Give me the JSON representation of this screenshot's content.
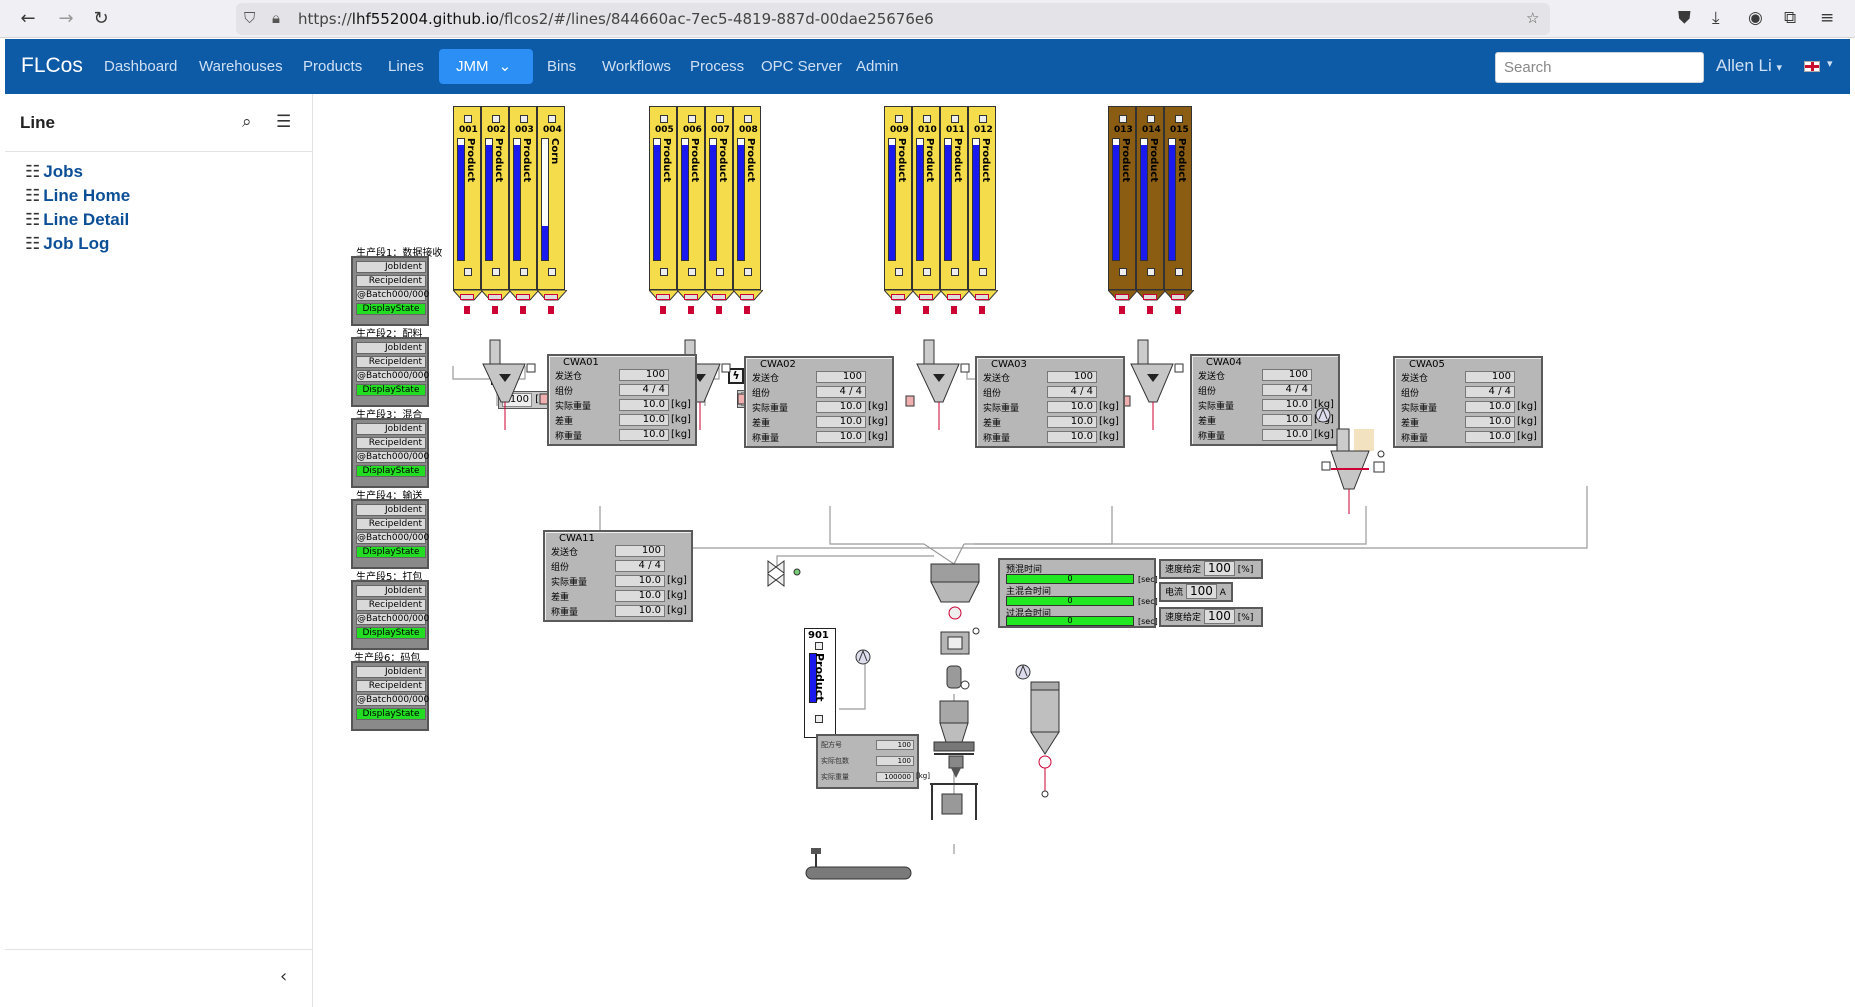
{
  "browser": {
    "url_prefix": "https://",
    "url_host": "lhf552004.github.io",
    "url_path": "/flcos2/#/lines/844660ac-7ec5-4819-887d-00dae25676e6"
  },
  "navbar": {
    "brand": "FLCos",
    "links": [
      "Dashboard",
      "Warehouses",
      "Products",
      "Lines"
    ],
    "dropdown": "JMM",
    "links2": [
      "Bins",
      "Workflows",
      "Process",
      "OPC Server",
      "Admin"
    ],
    "search_placeholder": "Search",
    "user": "Allen Li"
  },
  "sidebar": {
    "title": "Line",
    "items": [
      "Jobs",
      "Line Home",
      "Line Detail",
      "Job Log"
    ]
  },
  "stages": [
    {
      "title": "生产段1：数据接收",
      "job": "JobIdent",
      "recipe": "RecipeIdent",
      "batch": "@Batch000/000",
      "state": "DisplayState"
    },
    {
      "title": "生产段2：配料",
      "job": "JobIdent",
      "recipe": "RecipeIdent",
      "batch": "@Batch000/000",
      "state": "DisplayState"
    },
    {
      "title": "生产段3：混合",
      "job": "JobIdent",
      "recipe": "RecipeIdent",
      "batch": "@Batch000/000",
      "state": "DisplayState"
    },
    {
      "title": "生产段4：输送",
      "job": "JobIdent",
      "recipe": "RecipeIdent",
      "batch": "@Batch000/000",
      "state": "DisplayState"
    },
    {
      "title": "生产段5：打包",
      "job": "JobIdent",
      "recipe": "RecipeIdent",
      "batch": "@Batch000/000",
      "state": "DisplayState"
    },
    {
      "title": "生产段6：码包",
      "job": "JobIdent",
      "recipe": "RecipeIdent",
      "batch": "@Batch000/000",
      "state": "DisplayState"
    }
  ],
  "bins": [
    {
      "id": "001",
      "product": "Product",
      "level": 0.95,
      "color": "#f5dc4a"
    },
    {
      "id": "002",
      "product": "Product",
      "level": 0.95,
      "color": "#f5dc4a"
    },
    {
      "id": "003",
      "product": "Product",
      "level": 0.95,
      "color": "#f5dc4a"
    },
    {
      "id": "004",
      "product": "Corn",
      "level": 0.28,
      "color": "#f5dc4a"
    },
    {
      "id": "005",
      "product": "Product",
      "level": 0.95,
      "color": "#f5dc4a"
    },
    {
      "id": "006",
      "product": "Product",
      "level": 0.95,
      "color": "#f5dc4a"
    },
    {
      "id": "007",
      "product": "Product",
      "level": 0.95,
      "color": "#f5dc4a"
    },
    {
      "id": "008",
      "product": "Product",
      "level": 0.95,
      "color": "#f5dc4a"
    },
    {
      "id": "009",
      "product": "Product",
      "level": 0.95,
      "color": "#f5dc4a"
    },
    {
      "id": "010",
      "product": "Product",
      "level": 0.95,
      "color": "#f5dc4a"
    },
    {
      "id": "011",
      "product": "Product",
      "level": 0.95,
      "color": "#f5dc4a"
    },
    {
      "id": "012",
      "product": "Product",
      "level": 0.95,
      "color": "#f5dc4a"
    },
    {
      "id": "013",
      "product": "Product",
      "level": 0.95,
      "color": "#8a5d12"
    },
    {
      "id": "014",
      "product": "Product",
      "level": 0.95,
      "color": "#8a5d12"
    },
    {
      "id": "015",
      "product": "Product",
      "level": 0.95,
      "color": "#8a5d12"
    }
  ],
  "bin901": {
    "id": "901",
    "product": "Product"
  },
  "scale_pct": [
    "100",
    "100",
    "100",
    "100"
  ],
  "pct_unit": "[%]",
  "cwa_labels": [
    "发送仓",
    "组份",
    "实际重量",
    "差重",
    "称重量"
  ],
  "cwa": [
    {
      "name": "CWA01",
      "values": [
        "100",
        "4 / 4",
        "10.0",
        "10.0",
        "10.0"
      ]
    },
    {
      "name": "CWA02",
      "values": [
        "100",
        "4 / 4",
        "10.0",
        "10.0",
        "10.0"
      ]
    },
    {
      "name": "CWA03",
      "values": [
        "100",
        "4 / 4",
        "10.0",
        "10.0",
        "10.0"
      ]
    },
    {
      "name": "CWA04",
      "values": [
        "100",
        "4 / 4",
        "10.0",
        "10.0",
        "10.0"
      ]
    },
    {
      "name": "CWA05",
      "values": [
        "100",
        "4 / 4",
        "10.0",
        "10.0",
        "10.0"
      ]
    },
    {
      "name": "CWA11",
      "values": [
        "100",
        "4 / 4",
        "10.0",
        "10.0",
        "10.0"
      ]
    }
  ],
  "kg_unit": "[kg]",
  "mixer": {
    "pre_mix": "预混时间",
    "main_mix": "主混合时间",
    "post_mix": "过混合时间",
    "value": "0",
    "unit": "[sec]",
    "speed_label": "速度给定",
    "speed_value": "100",
    "speed_unit": "[%]",
    "current_label": "电流",
    "current_value": "100",
    "current_unit": "A",
    "speed2_label": "速度给定",
    "speed2_value": "100",
    "speed2_unit": "[%]"
  },
  "packer": {
    "rows": [
      "配方号",
      "实际包数",
      "实际重量"
    ],
    "values": [
      "100",
      "100",
      "100000"
    ],
    "unit": "[kg]"
  }
}
